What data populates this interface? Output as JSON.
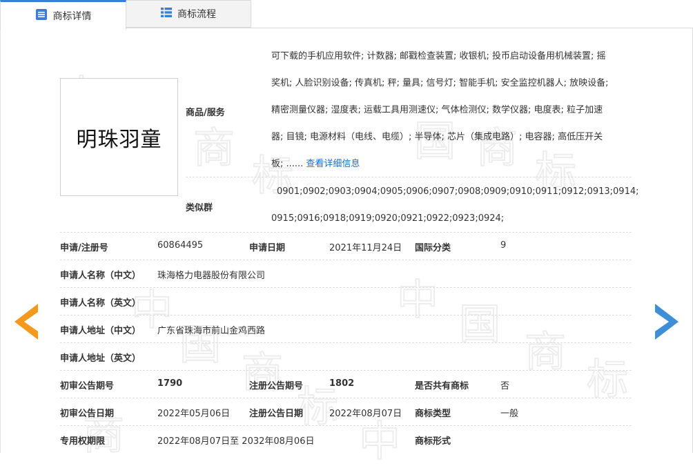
{
  "tabs": {
    "detail": "商标详情",
    "flow": "商标流程"
  },
  "watermark": "中国商标",
  "trademark": {
    "name": "明珠羽童"
  },
  "goods": {
    "label": "商品/服务",
    "lines": [
      "可下载的手机应用软件; 计数器; 邮戳检查装置; 收银机; 投币启动设备用机械装置; 摇",
      "奖机; 人脸识别设备; 传真机; 秤; 量具; 信号灯; 智能手机; 安全监控机器人; 放映设备;",
      "精密测量仪器; 湿度表; 运载工具用测速仪; 气体检测仪; 数学仪器; 电度表; 粒子加速",
      "器; 目镜; 电源材料（电线、电缆）; 半导体; 芯片（集成电路）; 电容器; 高低压开关",
      "板; ......"
    ],
    "more_link": "查看详细信息"
  },
  "similar": {
    "label": "类似群",
    "lines": [
      "0901;0902;0903;0904;0905;0906;0907;0908;0909;0910;0911;0912;0913;0914;",
      "0915;0916;0918;0919;0920;0921;0922;0923;0924;"
    ]
  },
  "fields": {
    "reg_no_label": "申请/注册号",
    "reg_no": "60864495",
    "app_date_label": "申请日期",
    "app_date": "2021年11月24日",
    "intl_class_label": "国际分类",
    "intl_class": "9",
    "applicant_cn_label": "申请人名称（中文）",
    "applicant_cn": "珠海格力电器股份有限公司",
    "applicant_en_label": "申请人名称（英文）",
    "address_cn_label": "申请人地址（中文）",
    "address_cn": "广东省珠海市前山金鸡西路",
    "address_en_label": "申请人地址（英文）",
    "prelim_issue_label": "初审公告期号",
    "prelim_issue": "1790",
    "reg_issue_label": "注册公告期号",
    "reg_issue": "1802",
    "shared_label": "是否共有商标",
    "shared": "否",
    "prelim_date_label": "初审公告日期",
    "prelim_date": "2022年05月06日",
    "reg_date_label": "注册公告日期",
    "reg_date": "2022年08月07日",
    "tm_type_label": "商标类型",
    "tm_type": "一般",
    "exclusive_label": "专用权期限",
    "exclusive": "2022年08月07日至 2032年08月06日",
    "tm_form_label": "商标形式"
  },
  "colors": {
    "accent": "#3a7fd5",
    "arrow_left": "#f39a1e",
    "arrow_right": "#3f8fd8",
    "link": "#1a6ec7"
  }
}
